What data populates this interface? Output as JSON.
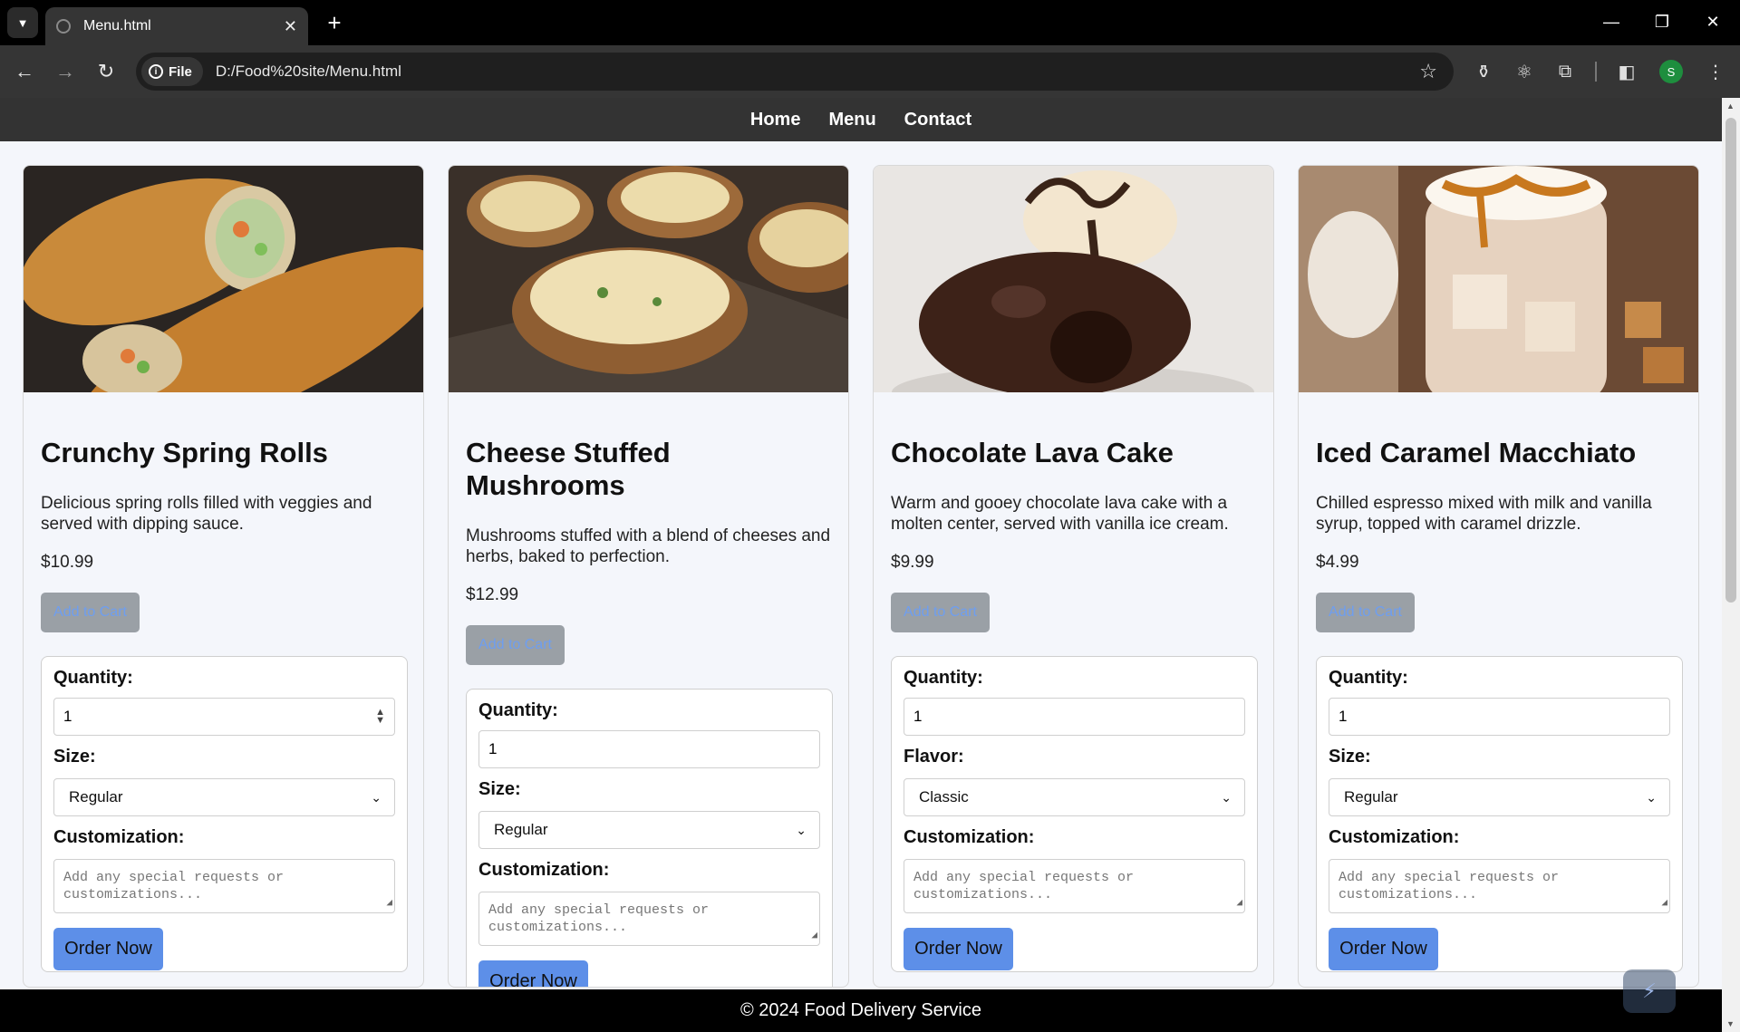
{
  "browser": {
    "tab_title": "Menu.html",
    "site_chip": "File",
    "url": "D:/Food%20site/Menu.html",
    "profile_initial": "S"
  },
  "header": {
    "links": [
      "Home",
      "Menu",
      "Contact"
    ]
  },
  "labels": {
    "quantity": "Quantity:",
    "customization": "Customization:",
    "textarea_placeholder": "Add any special requests or customizations...",
    "add_to_cart": "Add to Cart",
    "order_now": "Order Now"
  },
  "items": [
    {
      "title": "Crunchy Spring Rolls",
      "description": "Delicious spring rolls filled with veggies and served with dipping sauce.",
      "price": "$10.99",
      "quantity": "1",
      "option_label": "Size:",
      "option_value": "Regular"
    },
    {
      "title": "Cheese Stuffed Mushrooms",
      "description": "Mushrooms stuffed with a blend of cheeses and herbs, baked to perfection.",
      "price": "$12.99",
      "quantity": "1",
      "option_label": "Size:",
      "option_value": "Regular"
    },
    {
      "title": "Chocolate Lava Cake",
      "description": "Warm and gooey chocolate lava cake with a molten center, served with vanilla ice cream.",
      "price": "$9.99",
      "quantity": "1",
      "option_label": "Flavor:",
      "option_value": "Classic"
    },
    {
      "title": "Iced Caramel Macchiato",
      "description": "Chilled espresso mixed with milk and vanilla syrup, topped with caramel drizzle.",
      "price": "$4.99",
      "quantity": "1",
      "option_label": "Size:",
      "option_value": "Regular"
    }
  ],
  "footer": {
    "text": "© 2024 Food Delivery Service"
  },
  "colors": {
    "nav_bg": "#333333",
    "order_button": "#5d8fe8",
    "add_cart_disabled": "#9aa0a6",
    "footer_bg": "#000000"
  }
}
